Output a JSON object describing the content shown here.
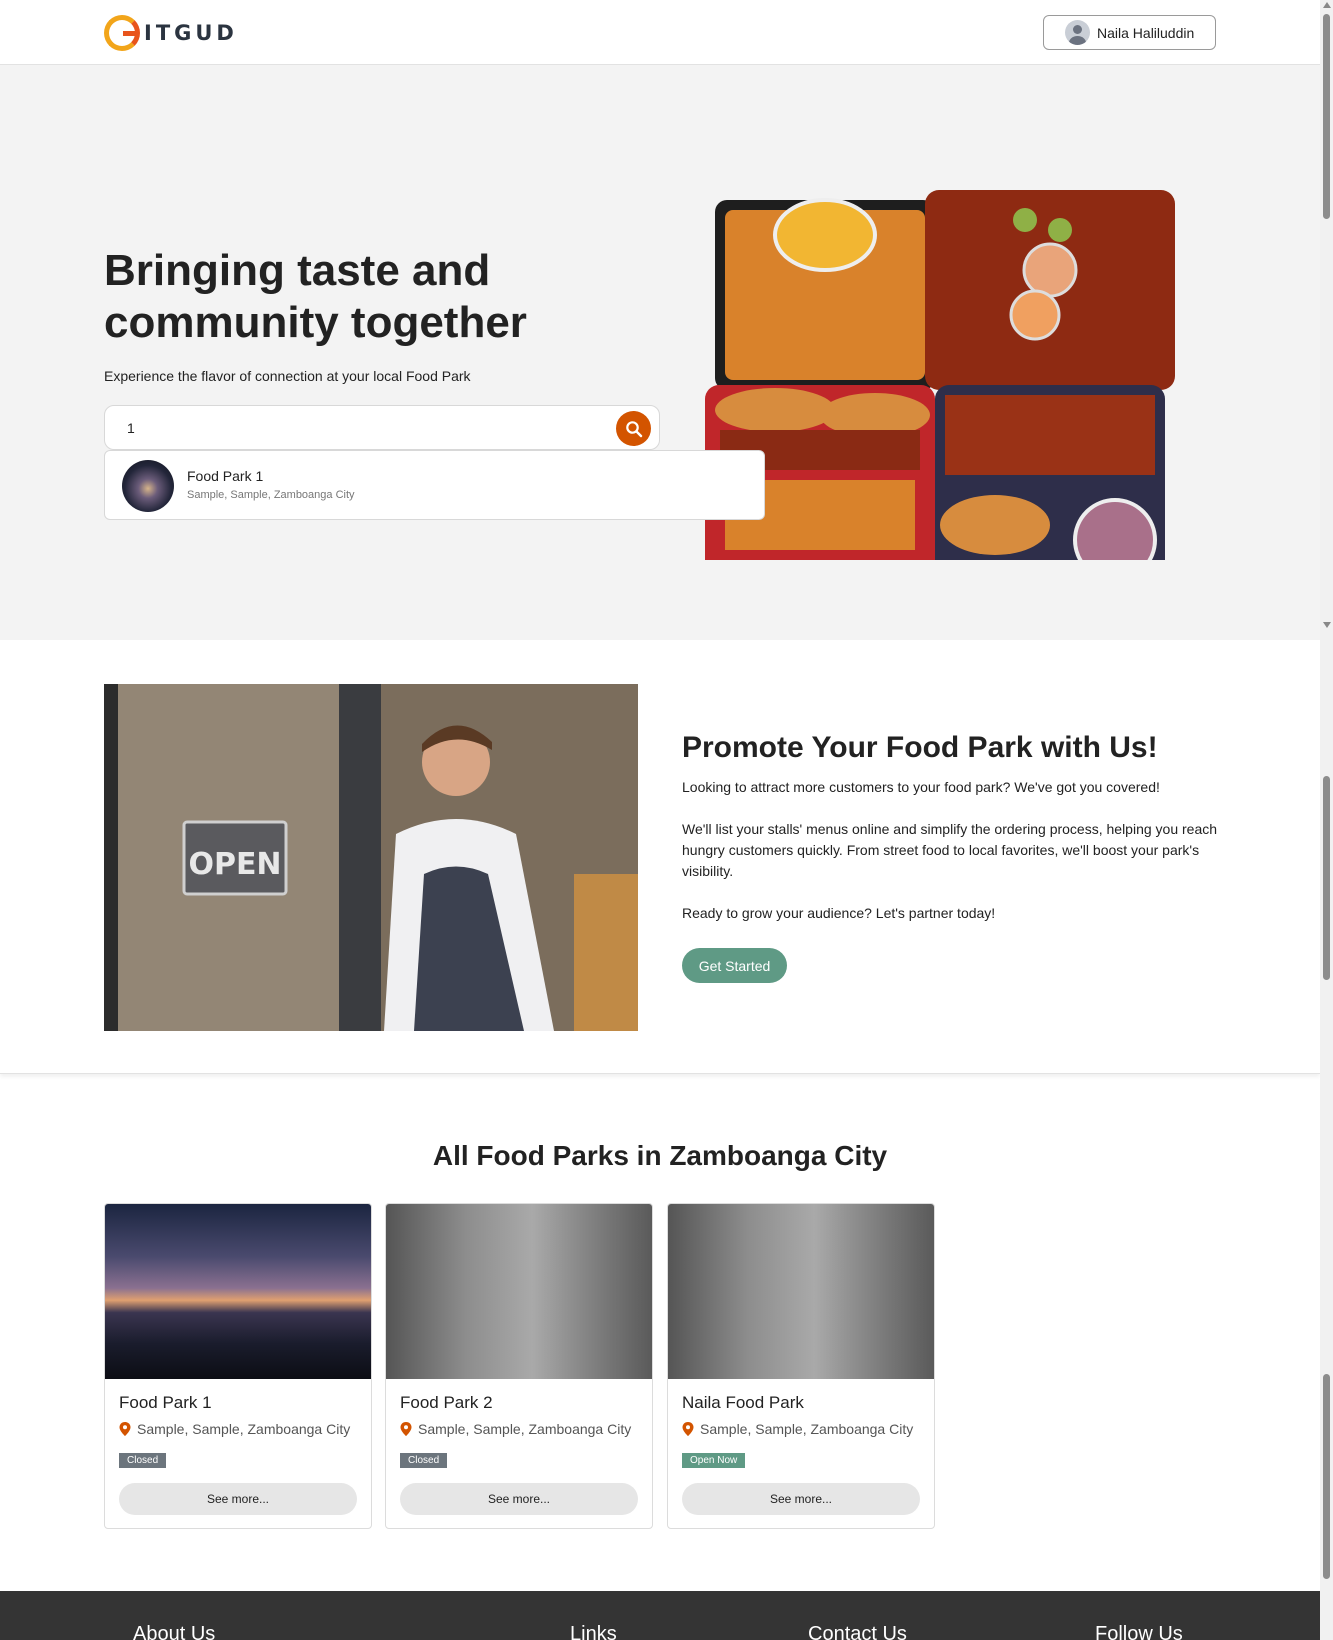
{
  "header": {
    "logo_text": "ITGUD",
    "user_name": "Naila Haliluddin"
  },
  "hero": {
    "title": "Bringing taste and community together",
    "subtitle": "Experience the flavor of connection at your local Food Park",
    "search_value": "1",
    "suggestion": {
      "name": "Food Park 1",
      "address": "Sample, Sample, Zamboanga City"
    }
  },
  "promo": {
    "title": "Promote Your Food Park with Us!",
    "p1": "Looking to attract more customers to your food park? We've got you covered!",
    "p2": "We'll list your stalls' menus online and simplify the ordering process, helping you reach hungry customers quickly. From street food to local favorites, we'll boost your park's visibility.",
    "p3": "Ready to grow your audience? Let's partner today!",
    "button": "Get Started",
    "sign_text": "OPEN"
  },
  "parks": {
    "title": "All Food Parks in Zamboanga City",
    "cards": [
      {
        "name": "Food Park 1",
        "location": "Sample, Sample, Zamboanga City",
        "status": "Closed",
        "button": "See more..."
      },
      {
        "name": "Food Park 2",
        "location": "Sample, Sample, Zamboanga City",
        "status": "Closed",
        "button": "See more..."
      },
      {
        "name": "Naila Food Park",
        "location": "Sample, Sample, Zamboanga City",
        "status": "Open Now",
        "button": "See more..."
      }
    ]
  },
  "footer": {
    "about": "About Us",
    "links": "Links",
    "contact": "Contact Us",
    "follow": "Follow Us"
  },
  "colors": {
    "accent_orange": "#d35400",
    "accent_green": "#5f9a85",
    "closed_gray": "#6c757d",
    "footer_bg": "#343434"
  }
}
